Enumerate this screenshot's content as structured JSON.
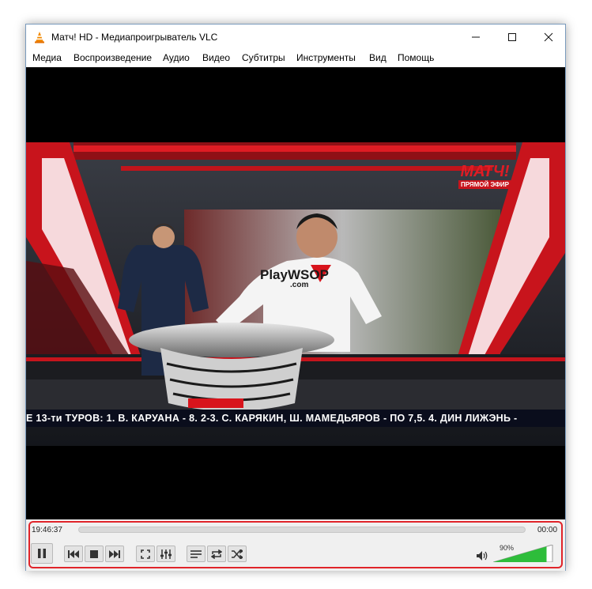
{
  "window": {
    "title": "Матч! HD - Медиапроигрыватель VLC",
    "buttons": {
      "minimize_icon": "minimize-icon",
      "maximize_icon": "maximize-icon",
      "close_icon": "close-icon"
    }
  },
  "menu": {
    "items": [
      "Медиа",
      "Воспроизведение",
      "Аудио",
      "Видео",
      "Субтитры",
      "Инструменты",
      "Вид",
      "Помощь"
    ]
  },
  "video": {
    "ticker": "Е 13-ти ТУРОВ: 1. В. КАРУАНА - 8. 2-3. С. КАРЯКИН, Ш. МАМЕДЬЯРОВ - ПО 7,5. 4. ДИН ЛИЖЭНЬ -",
    "logo_text": "МАТЧ!",
    "live_badge": "ПРЯМОЙ ЭФИР",
    "jersey_text": "PlayWSOP",
    "jersey_sub": ".com"
  },
  "controls": {
    "elapsed": "19:46:37",
    "remaining": "00:00",
    "volume_percent": "90%",
    "volume_level": 0.9,
    "buttons": [
      "pause",
      "previous",
      "stop",
      "next",
      "fullscreen",
      "extended-settings",
      "playlist",
      "loop",
      "random"
    ]
  },
  "colors": {
    "highlight": "#e0242a",
    "volume_green": "#2ebd3b",
    "studio_red": "#d8141c"
  }
}
